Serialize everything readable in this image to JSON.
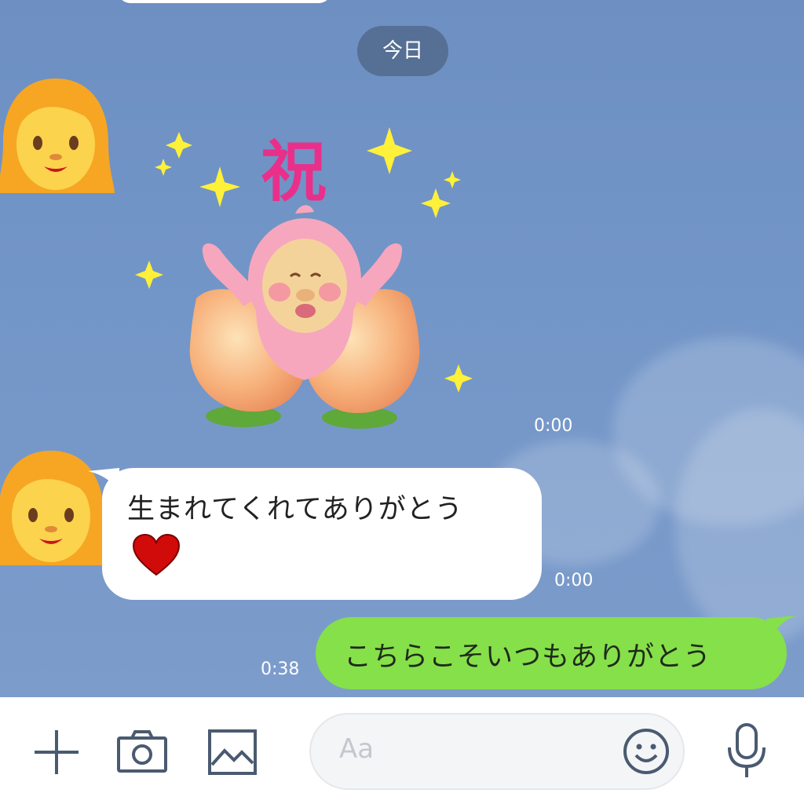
{
  "chat": {
    "date_divider": "今日",
    "messages": [
      {
        "type": "sticker",
        "sticker_text": "祝",
        "time": "0:00"
      },
      {
        "type": "text",
        "direction": "incoming",
        "text": "生まれてくれてありがとう",
        "time": "0:00"
      },
      {
        "type": "text",
        "direction": "outgoing",
        "text": "こちらこそいつもありがとう",
        "time": "0:38"
      }
    ]
  },
  "input_bar": {
    "placeholder": "Aa",
    "icons": [
      "plus-icon",
      "camera-icon",
      "image-icon",
      "emoji-icon",
      "microphone-icon"
    ]
  },
  "colors": {
    "chat_background": "#7396c8",
    "outgoing_bubble": "#86e04a",
    "incoming_bubble": "#ffffff",
    "icon": "#4a5a70"
  }
}
